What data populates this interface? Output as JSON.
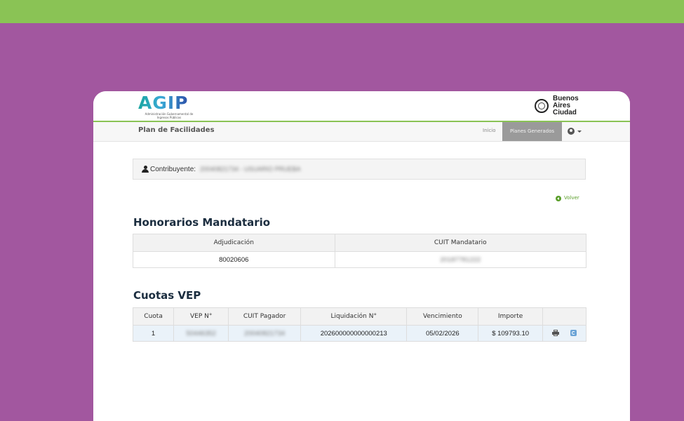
{
  "header": {
    "logo_text": "AGIP",
    "logo_subtitle": "Administración Gubernamental de Ingresos Públicos",
    "ba_logo_lines": [
      "Buenos",
      "Aires",
      "Ciudad"
    ]
  },
  "nav": {
    "title": "Plan de Facilidades",
    "items": [
      {
        "label": "Inicio",
        "active": false
      },
      {
        "label": "Planes Generados",
        "active": true
      }
    ],
    "user_icon": "user-circle-icon"
  },
  "contribuyente": {
    "label": "Contribuyente:",
    "value": "20040821734 - USUARIO PRUEBA"
  },
  "volver": {
    "label": "Volver"
  },
  "honorarios": {
    "title": "Honorarios Mandatario",
    "headers": [
      "Adjudicación",
      "CUIT Mandatario"
    ],
    "rows": [
      [
        "80020606",
        "20187781222"
      ]
    ]
  },
  "cuotas": {
    "title": "Cuotas VEP",
    "headers": [
      "Cuota",
      "VEP N°",
      "CUIT Pagador",
      "Liquidación N°",
      "Vencimiento",
      "Importe",
      ""
    ],
    "rows": [
      {
        "cuota": "1",
        "vep": "50446352",
        "cuit": "20040821734",
        "liquidacion": "202600000000000213",
        "vencimiento": "05/02/2026",
        "importe": "$ 109793.10"
      }
    ]
  },
  "colors": {
    "background": "#a2579f",
    "topbar": "#8ac355",
    "nav_active": "#9a9a9a",
    "title": "#1b2d3f",
    "volver": "#5a9e2a"
  }
}
